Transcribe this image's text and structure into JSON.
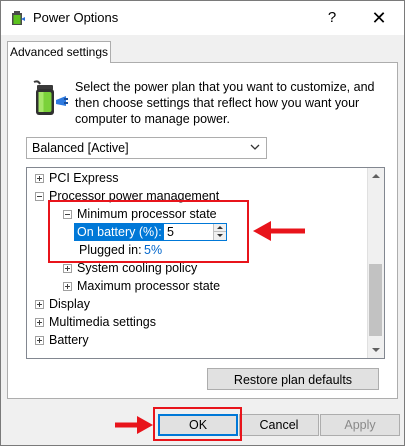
{
  "window": {
    "title": "Power Options",
    "help_glyph": "?",
    "close_glyph": "✕"
  },
  "tab": {
    "label": "Advanced settings"
  },
  "description": "Select the power plan that you want to customize, and then choose settings that reflect how you want your computer to manage power.",
  "plan_select": {
    "value": "Balanced [Active]"
  },
  "tree": {
    "items": [
      {
        "label": "PCI Express",
        "state": "collapsed",
        "level": 0
      },
      {
        "label": "Processor power management",
        "state": "expanded",
        "level": 0
      },
      {
        "label": "Minimum processor state",
        "state": "expanded",
        "level": 1
      },
      {
        "label": "On battery (%):",
        "level": 2,
        "value": "5",
        "selected": true
      },
      {
        "label": "Plugged in:",
        "level": 2,
        "value": "5%"
      },
      {
        "label": "System cooling policy",
        "state": "collapsed",
        "level": 1
      },
      {
        "label": "Maximum processor state",
        "state": "collapsed",
        "level": 1
      },
      {
        "label": "Display",
        "state": "collapsed",
        "level": 0
      },
      {
        "label": "Multimedia settings",
        "state": "collapsed",
        "level": 0
      },
      {
        "label": "Battery",
        "state": "collapsed",
        "level": 0
      }
    ]
  },
  "buttons": {
    "restore": "Restore plan defaults",
    "ok": "OK",
    "cancel": "Cancel",
    "apply": "Apply"
  },
  "colors": {
    "selection": "#0078d7",
    "annotation": "#e8141b",
    "link_value": "#0066cc"
  },
  "icons": {
    "title": "power-options-icon",
    "battery": "battery-plug-icon"
  }
}
